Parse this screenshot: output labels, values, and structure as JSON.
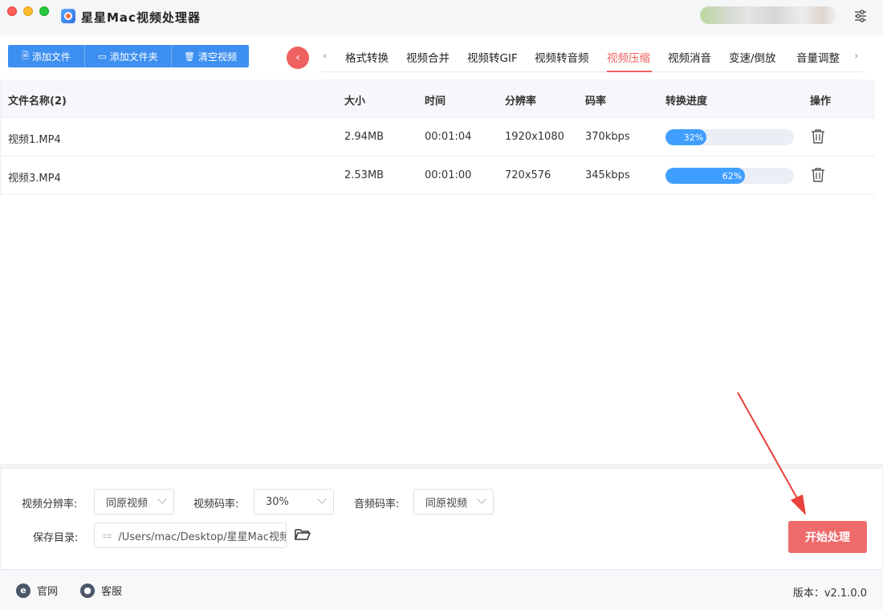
{
  "window": {
    "title": "星星Mac视频处理器"
  },
  "toolbar": {
    "add_file": "添加文件",
    "add_folder": "添加文件夹",
    "clear_videos": "清空视频"
  },
  "tabs": [
    {
      "label": "格式转换",
      "active": false
    },
    {
      "label": "视频合并",
      "active": false
    },
    {
      "label": "视频转GIF",
      "active": false
    },
    {
      "label": "视频转音频",
      "active": false
    },
    {
      "label": "视频压缩",
      "active": true
    },
    {
      "label": "视频消音",
      "active": false
    },
    {
      "label": "变速/倒放",
      "active": false
    },
    {
      "label": "音量调整",
      "active": false
    }
  ],
  "table": {
    "headers": {
      "name": "文件名称(2)",
      "size": "大小",
      "time": "时间",
      "resolution": "分辨率",
      "bitrate": "码率",
      "progress": "转换进度",
      "ops": "操作"
    },
    "rows": [
      {
        "name": "视频1.MP4",
        "size": "2.94MB",
        "time": "00:01:04",
        "resolution": "1920x1080",
        "bitrate": "370kbps",
        "progress_label": "32%",
        "progress": 0.32
      },
      {
        "name": "视频3.MP4",
        "size": "2.53MB",
        "time": "00:01:00",
        "resolution": "720x576",
        "bitrate": "345kbps",
        "progress_label": "62%",
        "progress": 0.62
      }
    ]
  },
  "settings": {
    "video_resolution_label": "视频分辨率:",
    "video_resolution_value": "同原视频",
    "video_bitrate_label": "视频码率:",
    "video_bitrate_value": "30%",
    "audio_bitrate_label": "音频码率:",
    "audio_bitrate_value": "同原视频",
    "save_dir_label": "保存目录:",
    "save_dir_value": "/Users/mac/Desktop/星星Mac视频",
    "start_button": "开始处理"
  },
  "footer": {
    "website": "官网",
    "support": "客服",
    "version": "版本：v2.1.0.0"
  },
  "colors": {
    "primary_blue": "#3d8ff0",
    "accent_red": "#ef6060",
    "progress_blue": "#409eff"
  }
}
